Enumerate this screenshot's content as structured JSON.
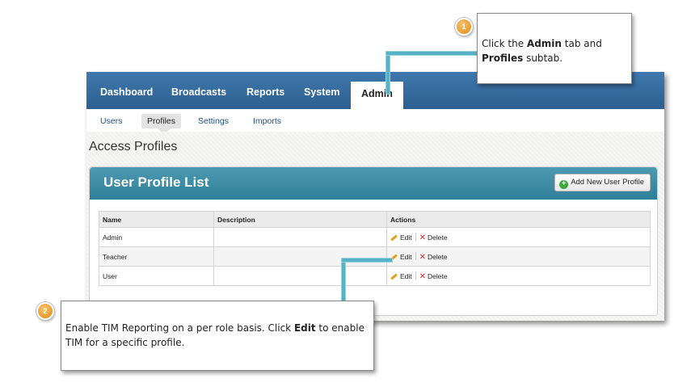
{
  "nav": {
    "tabs": [
      "Dashboard",
      "Broadcasts",
      "Reports",
      "System",
      "Admin"
    ],
    "active_tab": "Admin",
    "subtabs": [
      "Users",
      "Profiles",
      "Settings",
      "Imports"
    ],
    "active_subtab": "Profiles"
  },
  "page": {
    "title": "Access Profiles"
  },
  "panel": {
    "title": "User Profile List",
    "add_button": "Add New User Profile"
  },
  "table": {
    "headers": [
      "Name",
      "Description",
      "Actions"
    ],
    "rows": [
      {
        "name": "Admin",
        "description": "",
        "edit": "Edit",
        "delete": "Delete"
      },
      {
        "name": "Teacher",
        "description": "",
        "edit": "Edit",
        "delete": "Delete"
      },
      {
        "name": "User",
        "description": "",
        "edit": "Edit",
        "delete": "Delete"
      }
    ]
  },
  "callouts": {
    "one": {
      "number": "1",
      "text_a": "Click the ",
      "bold_a": "Admin",
      "text_b": " tab and ",
      "bold_b": "Profiles",
      "text_c": " subtab."
    },
    "two": {
      "number": "2",
      "text_a": "Enable TIM Reporting on a per role basis. Click ",
      "bold_a": "Edit",
      "text_b": " to enable TIM for a specific profile."
    }
  },
  "colors": {
    "nav_blue": "#2d5f91",
    "panel_teal": "#2f7f98",
    "leader": "#54b3c6",
    "badge_orange": "#e08a16"
  }
}
